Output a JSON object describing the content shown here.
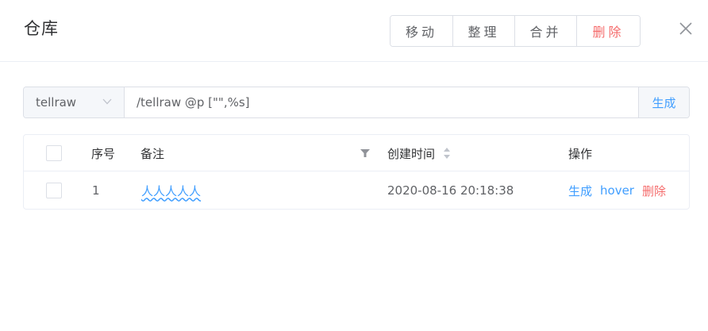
{
  "header": {
    "title": "仓库",
    "buttons": {
      "move": "移动",
      "organize": "整理",
      "merge": "合并",
      "delete": "删除"
    }
  },
  "command": {
    "type_selected": "tellraw",
    "input_value": "/tellraw @p [\"\",%s]",
    "generate_label": "生成"
  },
  "table": {
    "columns": {
      "index": "序号",
      "remark": "备注",
      "created": "创建时间",
      "actions": "操作"
    },
    "rows": [
      {
        "index": "1",
        "remark": "人人人人人",
        "created": "2020-08-16 20:18:38",
        "actions": {
          "generate": "生成",
          "hover": "hover",
          "delete": "删除"
        }
      }
    ]
  },
  "colors": {
    "primary": "#409eff",
    "danger": "#f56c6c",
    "border": "#dcdfe6",
    "text": "#606266"
  },
  "icons": [
    "close-icon",
    "chevron-down-icon",
    "filter-icon",
    "sort-icon"
  ]
}
